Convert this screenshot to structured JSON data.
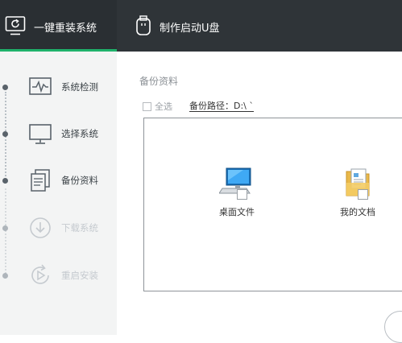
{
  "header": {
    "tabs": [
      {
        "label": "一键重装系统",
        "icon": "monitor-refresh-icon",
        "active": true
      },
      {
        "label": "制作启动U盘",
        "icon": "usb-drive-icon",
        "active": false
      }
    ],
    "accent_color": "#1fb26b",
    "background_color": "#2f3438"
  },
  "sidebar": {
    "steps": [
      {
        "label": "系统检测",
        "icon": "pulse-monitor-icon",
        "state": "done"
      },
      {
        "label": "选择系统",
        "icon": "monitor-icon",
        "state": "done"
      },
      {
        "label": "备份资料",
        "icon": "documents-icon",
        "state": "active"
      },
      {
        "label": "下载系统",
        "icon": "download-icon",
        "state": "pending"
      },
      {
        "label": "重启安装",
        "icon": "restart-icon",
        "state": "pending"
      }
    ],
    "active_color": "#59626a",
    "pending_color": "#c5cacf"
  },
  "main": {
    "section_title": "备份资料",
    "select_all_label": "全选",
    "backup_path": "备份路径：D:\\ ˋ",
    "files": [
      {
        "label": "桌面文件",
        "icon": "desktop-computer-icon",
        "checked": false
      },
      {
        "label": "我的文档",
        "icon": "my-documents-folder-icon",
        "checked": false
      }
    ]
  }
}
